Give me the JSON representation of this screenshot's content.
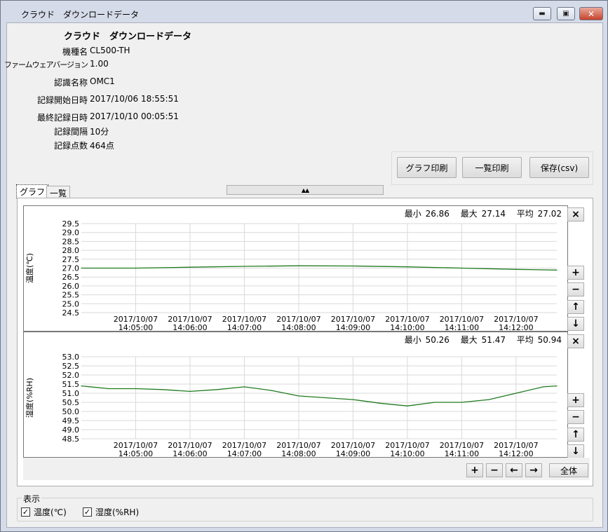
{
  "window": {
    "title": "クラウド　ダウンロードデータ",
    "minimize": "▬",
    "maximize": "▣",
    "close": "✕"
  },
  "info": {
    "heading": "クラウド　ダウンロードデータ",
    "rows": [
      {
        "label": "機種名",
        "value": "CL500-TH"
      },
      {
        "label": "ファームウェアバージョン",
        "value": "1.00"
      },
      {
        "label": "認識名称",
        "value": "OMC1"
      },
      {
        "label": "記録開始日時",
        "value": "2017/10/06 18:55:51"
      },
      {
        "label": "最終記録日時",
        "value": "2017/10/10 00:05:51"
      },
      {
        "label": "記録間隔",
        "value": "10分"
      },
      {
        "label": "記録点数",
        "value": "464点"
      }
    ]
  },
  "actions": {
    "print_graph": "グラフ印刷",
    "print_list": "一覧印刷",
    "save_csv": "保存(csv)"
  },
  "splitter_label": "▲▲",
  "tabs": [
    {
      "label": "グラフ",
      "active": true
    },
    {
      "label": "一覧",
      "active": false
    }
  ],
  "side_buttons": {
    "close": "×",
    "zoom_in": "+",
    "zoom_out": "−",
    "up": "↑",
    "down": "↓"
  },
  "nav": {
    "zoom_in": "+",
    "zoom_out": "−",
    "left": "←",
    "right": "→",
    "all": "全体"
  },
  "display": {
    "legend": "表示",
    "temp_label": "温度(℃)",
    "temp_checked": true,
    "hum_label": "湿度(%RH)",
    "hum_checked": true
  },
  "chart_data": [
    {
      "type": "line",
      "ylabel": "温度(℃)",
      "ylim": [
        24.5,
        29.5
      ],
      "yticks": [
        29.5,
        29.0,
        28.5,
        28.0,
        27.5,
        27.0,
        26.5,
        26.0,
        25.5,
        25.0,
        24.5
      ],
      "ytick_labels": [
        "29.5",
        "29.0",
        "28.5",
        "28.0",
        "27.5",
        "27.0",
        "26.5",
        "26.0",
        "25.5",
        "25.0",
        "24.5"
      ],
      "xticks": [
        [
          "2017/10/07",
          "14:05:00"
        ],
        [
          "2017/10/07",
          "14:06:00"
        ],
        [
          "2017/10/07",
          "14:07:00"
        ],
        [
          "2017/10/07",
          "14:08:00"
        ],
        [
          "2017/10/07",
          "14:09:00"
        ],
        [
          "2017/10/07",
          "14:10:00"
        ],
        [
          "2017/10/07",
          "14:11:00"
        ],
        [
          "2017/10/07",
          "14:12:00"
        ]
      ],
      "stats": {
        "min_label": "最小",
        "min": "26.86",
        "max_label": "最大",
        "max": "27.14",
        "avg_label": "平均",
        "avg": "27.02"
      },
      "color": "#1f7a1f",
      "series": [
        {
          "x": [
            "14:04:00",
            "14:05:00",
            "14:06:00",
            "14:07:00",
            "14:08:00",
            "14:09:00",
            "14:10:00",
            "14:11:00",
            "14:12:00",
            "14:12:45"
          ],
          "values": [
            27.0,
            27.0,
            27.05,
            27.1,
            27.13,
            27.12,
            27.07,
            27.0,
            26.93,
            26.89
          ]
        }
      ]
    },
    {
      "type": "line",
      "ylabel": "湿度(%RH)",
      "ylim": [
        48.5,
        53.0
      ],
      "yticks": [
        53.0,
        52.5,
        52.0,
        51.5,
        51.0,
        50.5,
        50.0,
        49.5,
        49.0,
        48.5
      ],
      "ytick_labels": [
        "53.0",
        "52.5",
        "52.0",
        "51.5",
        "51.0",
        "50.5",
        "50.0",
        "49.5",
        "49.0",
        "48.5"
      ],
      "xticks": [
        [
          "2017/10/07",
          "14:05:00"
        ],
        [
          "2017/10/07",
          "14:06:00"
        ],
        [
          "2017/10/07",
          "14:07:00"
        ],
        [
          "2017/10/07",
          "14:08:00"
        ],
        [
          "2017/10/07",
          "14:09:00"
        ],
        [
          "2017/10/07",
          "14:10:00"
        ],
        [
          "2017/10/07",
          "14:11:00"
        ],
        [
          "2017/10/07",
          "14:12:00"
        ]
      ],
      "stats": {
        "min_label": "最小",
        "min": "50.26",
        "max_label": "最大",
        "max": "51.47",
        "avg_label": "平均",
        "avg": "50.94"
      },
      "color": "#1f7a1f",
      "series": [
        {
          "x": [
            "14:04:00",
            "14:04:30",
            "14:05:00",
            "14:05:30",
            "14:06:00",
            "14:06:30",
            "14:07:00",
            "14:07:30",
            "14:08:00",
            "14:08:30",
            "14:09:00",
            "14:09:30",
            "14:10:00",
            "14:10:30",
            "14:11:00",
            "14:11:30",
            "14:12:00",
            "14:12:30",
            "14:12:45"
          ],
          "values": [
            51.4,
            51.25,
            51.25,
            51.2,
            51.1,
            51.2,
            51.35,
            51.15,
            50.85,
            50.75,
            50.65,
            50.45,
            50.3,
            50.5,
            50.5,
            50.65,
            51.0,
            51.35,
            51.4
          ]
        }
      ]
    }
  ]
}
